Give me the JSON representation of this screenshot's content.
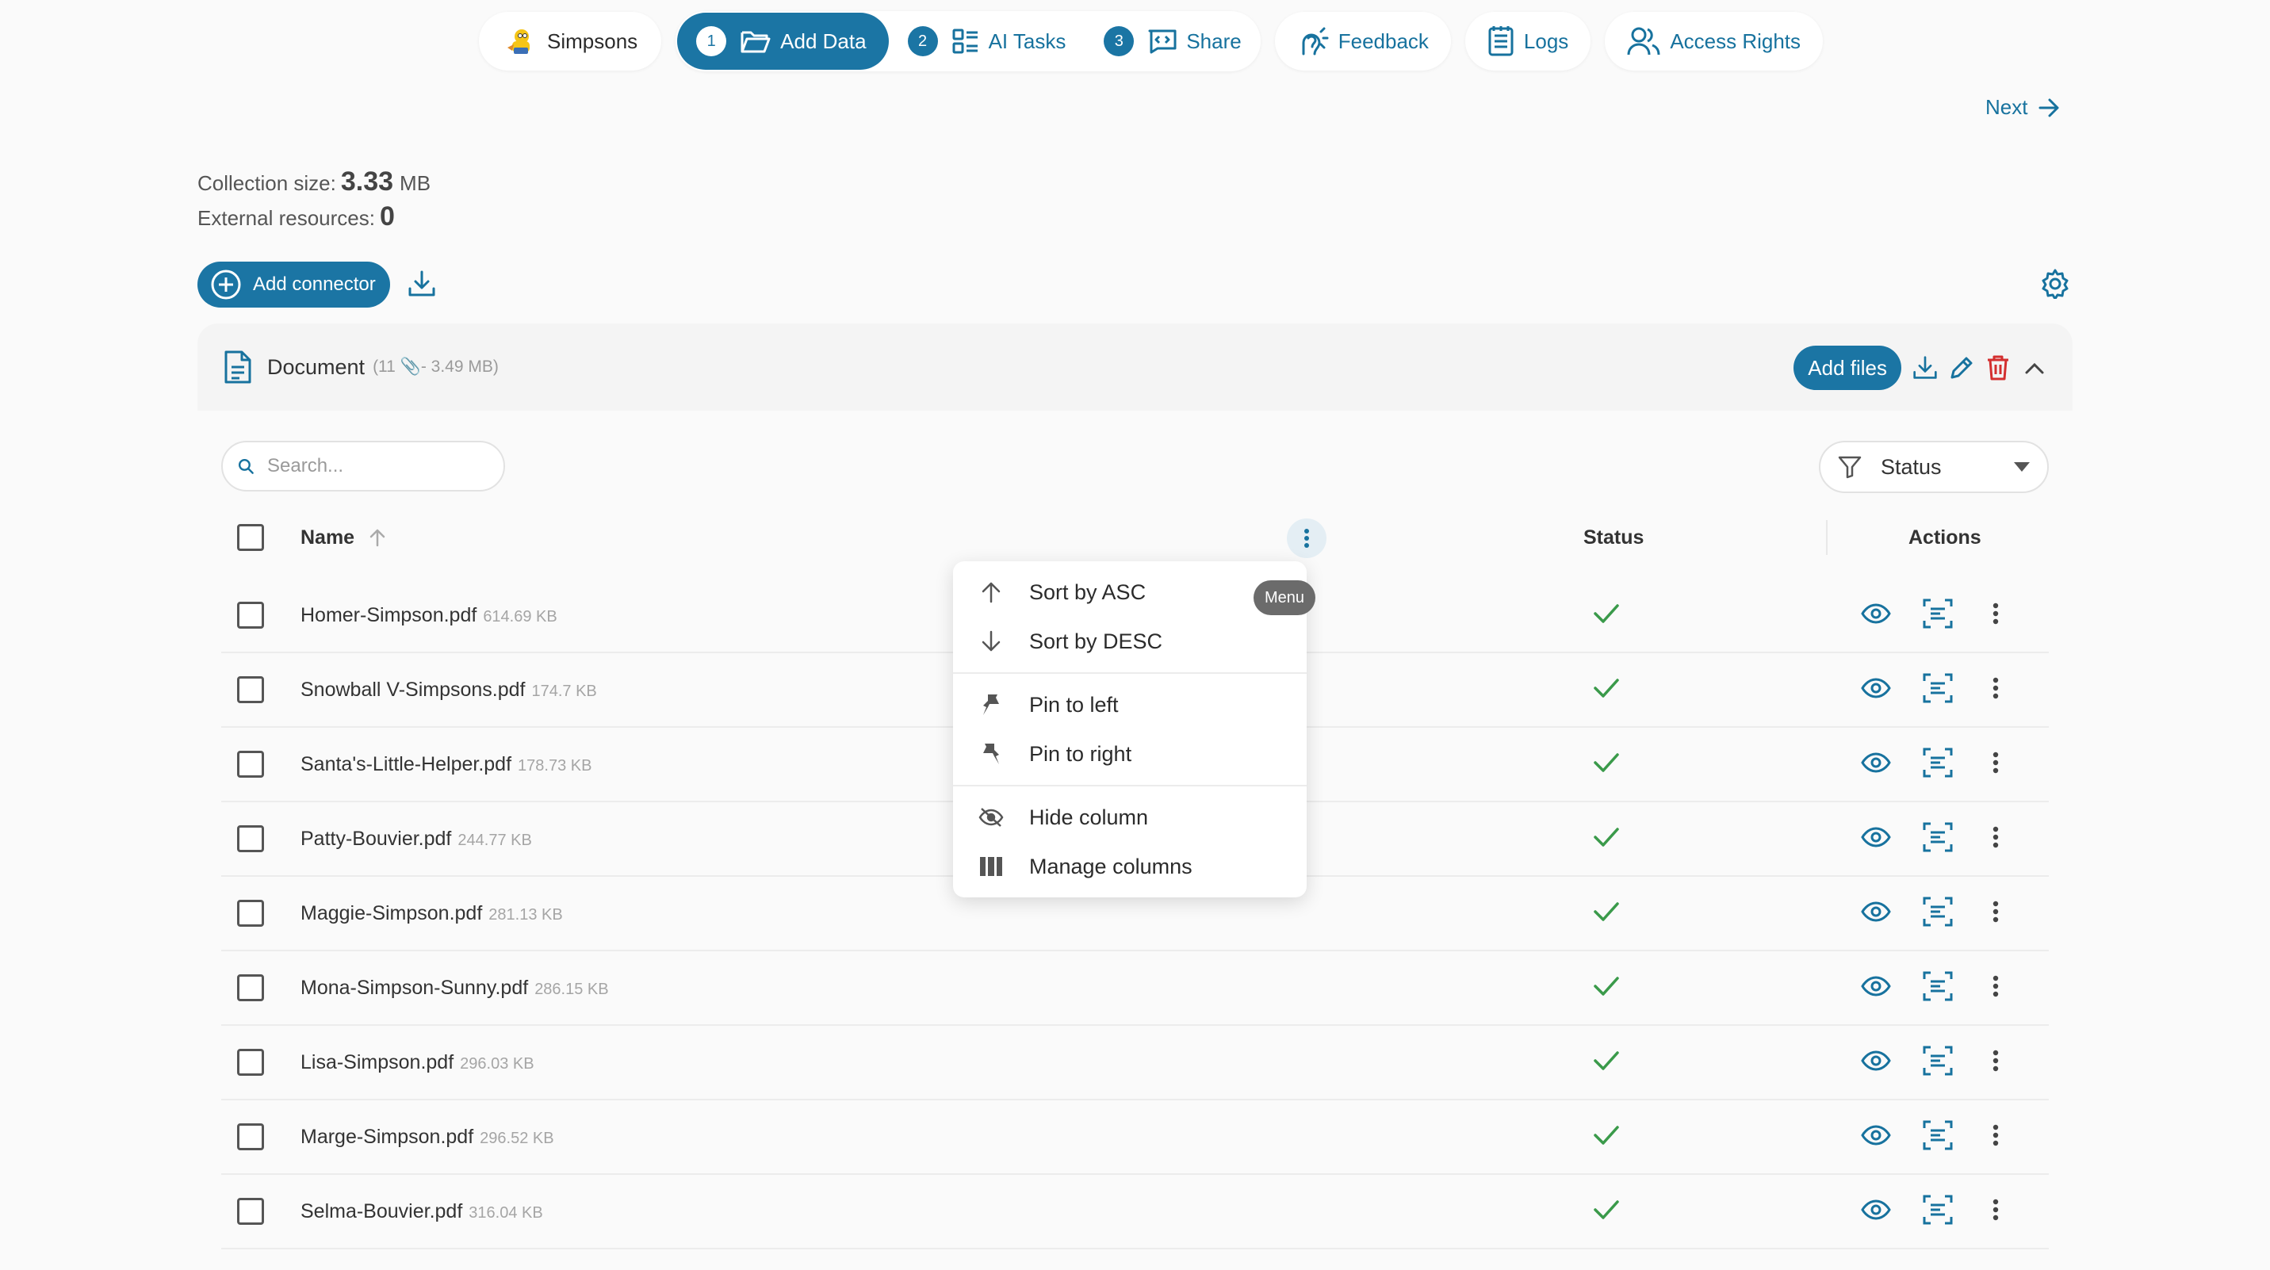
{
  "nav": {
    "brand": "Simpsons",
    "steps": [
      {
        "num": "1",
        "label": "Add Data"
      },
      {
        "num": "2",
        "label": "AI Tasks"
      },
      {
        "num": "3",
        "label": "Share"
      }
    ],
    "feedback": "Feedback",
    "logs": "Logs",
    "access": "Access Rights"
  },
  "next_label": "Next",
  "stats": {
    "collection_label": "Collection size:",
    "collection_value": "3.33",
    "collection_unit": "MB",
    "external_label": "External resources:",
    "external_value": "0"
  },
  "add_connector": "Add connector",
  "panel": {
    "title": "Document",
    "meta": "(11 📎- 3.49 MB)",
    "add_files": "Add files"
  },
  "search": {
    "placeholder": "Search..."
  },
  "status_filter": "Status",
  "columns": {
    "name": "Name",
    "status": "Status",
    "actions": "Actions"
  },
  "rows": [
    {
      "name": "Homer-Simpson.pdf",
      "size": "614.69 KB"
    },
    {
      "name": "Snowball V-Simpsons.pdf",
      "size": "174.7 KB"
    },
    {
      "name": "Santa's-Little-Helper.pdf",
      "size": "178.73 KB"
    },
    {
      "name": "Patty-Bouvier.pdf",
      "size": "244.77 KB"
    },
    {
      "name": "Maggie-Simpson.pdf",
      "size": "281.13 KB"
    },
    {
      "name": "Mona-Simpson-Sunny.pdf",
      "size": "286.15 KB"
    },
    {
      "name": "Lisa-Simpson.pdf",
      "size": "296.03 KB"
    },
    {
      "name": "Marge-Simpson.pdf",
      "size": "296.52 KB"
    },
    {
      "name": "Selma-Bouvier.pdf",
      "size": "316.04 KB"
    }
  ],
  "menu": {
    "sort_asc": "Sort by ASC",
    "sort_desc": "Sort by DESC",
    "pin_left": "Pin to left",
    "pin_right": "Pin to right",
    "hide": "Hide column",
    "manage": "Manage columns",
    "tooltip": "Menu"
  },
  "colors": {
    "accent": "#1b75a4",
    "success": "#3a9a4a",
    "danger": "#d32f2f"
  }
}
